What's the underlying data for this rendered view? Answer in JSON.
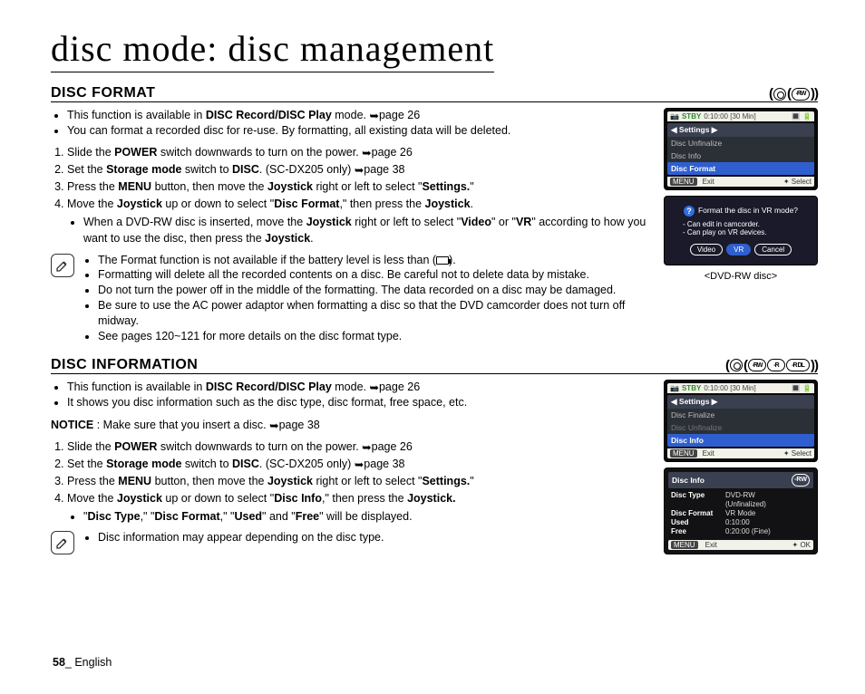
{
  "page_title": "disc mode: disc management",
  "page_number": "58",
  "page_lang": "English",
  "sec1": {
    "title": "DISC FORMAT",
    "icons": {
      "disc1": "-RW"
    },
    "intro": [
      {
        "prefix": "This function is available in ",
        "bold": "DISC Record/DISC Play",
        "suffix": " mode. ",
        "ref": "page 26"
      },
      {
        "text": "You can format a recorded disc for re-use. By formatting, all existing data will be deleted."
      }
    ],
    "steps": [
      {
        "p1": "Slide the ",
        "b1": "POWER",
        "p2": " switch downwards to turn on the power. ",
        "ref": "page 26"
      },
      {
        "p1": "Set the ",
        "b1": "Storage mode",
        "p2": " switch to ",
        "b2": "DISC",
        "p3": ". (SC-DX205 only) ",
        "ref": "page 38"
      },
      {
        "p1": "Press the ",
        "b1": "MENU",
        "p2": " button, then move the ",
        "b2": "Joystick",
        "p3": " right or left to select \"",
        "b3": "Settings.",
        "p4": "\""
      },
      {
        "p1": "Move the ",
        "b1": "Joystick",
        "p2": " up or down to select \"",
        "b2": "Disc Format",
        "p3": ",\" then press the ",
        "b3": "Joystick",
        "p4": ".",
        "sub": {
          "s1": "When a DVD-RW disc is inserted, move the ",
          "sb1": "Joystick",
          "s2": " right or left to select \"",
          "sb2": "Video",
          "s3": "\" or \"",
          "sb3": "VR",
          "s4": "\" according to how you want to use the disc, then press the ",
          "sb4": "Joystick",
          "s5": "."
        }
      }
    ],
    "notes": [
      "The Format function is not available if the battery level is less than (",
      "Formatting will delete all the recorded contents on a disc. Be careful not to delete data by mistake.",
      "Do not turn the power off in the middle of the formatting. The data recorded on a disc may be damaged.",
      "Be sure to use the AC power adaptor when formatting a disc so that the DVD camcorder does not turn off midway.",
      "See pages 120~121 for more details on the disc format type."
    ],
    "screen": {
      "stby": "STBY",
      "time": "0:10:00 [30 Min]",
      "hdr": "Settings",
      "items": [
        "Disc Unfinalize",
        "Disc Info",
        "Disc Format"
      ],
      "sel_index": 2,
      "menu": "MENU",
      "exit": "Exit",
      "sel": "Select"
    },
    "dialog": {
      "q": "Format the disc in VR mode?",
      "l1": "- Can edit in camcorder.",
      "l2": "- Can play on VR devices.",
      "btns": [
        "Video",
        "VR",
        "Cancel"
      ],
      "sel": 1,
      "caption": "<DVD-RW disc>"
    }
  },
  "sec2": {
    "title": "DISC INFORMATION",
    "icons": {
      "d1": "-RW",
      "d2": "-R",
      "d3": "-R DL"
    },
    "intro": [
      {
        "prefix": "This function is available in ",
        "bold": "DISC Record/DISC Play",
        "suffix": " mode. ",
        "ref": "page 26"
      },
      {
        "text": "It shows you disc information such as the disc type, disc format, free space, etc."
      }
    ],
    "notice": {
      "label": "NOTICE",
      "text": " : Make sure that you insert a disc. ",
      "ref": "page 38"
    },
    "steps": [
      {
        "p1": "Slide the ",
        "b1": "POWER",
        "p2": " switch downwards to turn on the power. ",
        "ref": "page 26"
      },
      {
        "p1": "Set the ",
        "b1": "Storage mode",
        "p2": " switch to ",
        "b2": "DISC",
        "p3": ". (SC-DX205 only) ",
        "ref": "page 38"
      },
      {
        "p1": "Press the ",
        "b1": "MENU",
        "p2": " button, then move the ",
        "b2": "Joystick",
        "p3": " right or left to select \"",
        "b3": "Settings.",
        "p4": "\""
      },
      {
        "p1": "Move the ",
        "b1": "Joystick",
        "p2": " up or down to select \"",
        "b2": "Disc Info",
        "p3": ",\" then press the ",
        "b3": "Joystick.",
        "p4": "",
        "sub": {
          "line": "\"Disc Type,\" \"Disc Format,\" \"Used\" and \"Free\" will be displayed.",
          "b": [
            "Disc Type",
            "Disc Format",
            "Used",
            "Free"
          ]
        }
      }
    ],
    "note_single": "Disc information may appear depending on the disc type.",
    "screen": {
      "stby": "STBY",
      "time": "0:10:00 [30 Min]",
      "hdr": "Settings",
      "items": [
        "Disc Finalize",
        "Disc Unfinalize",
        "Disc Info"
      ],
      "sel_index": 2,
      "menu": "MENU",
      "exit": "Exit",
      "sel": "Select"
    },
    "info": {
      "hdr": "Disc Info",
      "rows": [
        [
          "Disc Type",
          "DVD-RW"
        ],
        [
          "",
          "(Unfinalized)"
        ],
        [
          "Disc Format",
          "VR Mode"
        ],
        [
          "Used",
          "0:10:00"
        ],
        [
          "Free",
          "0:20:00 (Fine)"
        ]
      ],
      "menu": "MENU",
      "exit": "Exit",
      "ok": "OK"
    }
  }
}
